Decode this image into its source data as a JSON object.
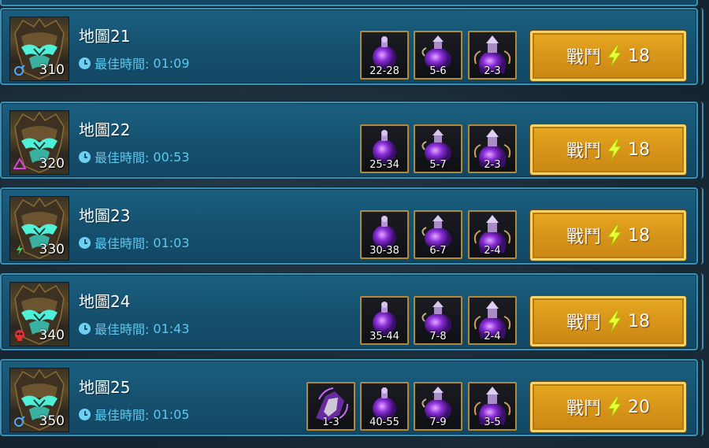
{
  "best_time_label": "最佳時間:",
  "fight_label": "戰鬥",
  "stages": [
    {
      "title": "地圖21",
      "best_time": "01:09",
      "level": "310",
      "affinity_icon": "magic-affinity-icon",
      "affinity_color": "#4aa8ff",
      "rewards": [
        {
          "icon": "small-potion-icon",
          "qty": "22-28"
        },
        {
          "icon": "medium-potion-icon",
          "qty": "5-6"
        },
        {
          "icon": "large-potion-icon",
          "qty": "2-3"
        }
      ],
      "energy_cost": "18"
    },
    {
      "title": "地圖22",
      "best_time": "00:53",
      "level": "320",
      "affinity_icon": "spirit-affinity-icon",
      "affinity_color": "#e040e0",
      "rewards": [
        {
          "icon": "small-potion-icon",
          "qty": "25-34"
        },
        {
          "icon": "medium-potion-icon",
          "qty": "5-7"
        },
        {
          "icon": "large-potion-icon",
          "qty": "2-3"
        }
      ],
      "energy_cost": "18"
    },
    {
      "title": "地圖23",
      "best_time": "01:03",
      "level": "330",
      "affinity_icon": "force-affinity-icon",
      "affinity_color": "#3fd04a",
      "rewards": [
        {
          "icon": "small-potion-icon",
          "qty": "30-38"
        },
        {
          "icon": "medium-potion-icon",
          "qty": "6-7"
        },
        {
          "icon": "large-potion-icon",
          "qty": "2-4"
        }
      ],
      "energy_cost": "18"
    },
    {
      "title": "地圖24",
      "best_time": "01:43",
      "level": "340",
      "affinity_icon": "void-affinity-icon",
      "affinity_color": "#e03030",
      "rewards": [
        {
          "icon": "small-potion-icon",
          "qty": "35-44"
        },
        {
          "icon": "medium-potion-icon",
          "qty": "7-8"
        },
        {
          "icon": "large-potion-icon",
          "qty": "2-4"
        }
      ],
      "energy_cost": "18"
    },
    {
      "title": "地圖25",
      "best_time": "01:05",
      "level": "350",
      "affinity_icon": "magic-affinity-icon",
      "affinity_color": "#4aa8ff",
      "rewards": [
        {
          "icon": "shard-icon",
          "qty": "1-3"
        },
        {
          "icon": "small-potion-icon",
          "qty": "40-55"
        },
        {
          "icon": "medium-potion-icon",
          "qty": "7-9"
        },
        {
          "icon": "large-potion-icon",
          "qty": "3-5"
        }
      ],
      "energy_cost": "20"
    }
  ]
}
